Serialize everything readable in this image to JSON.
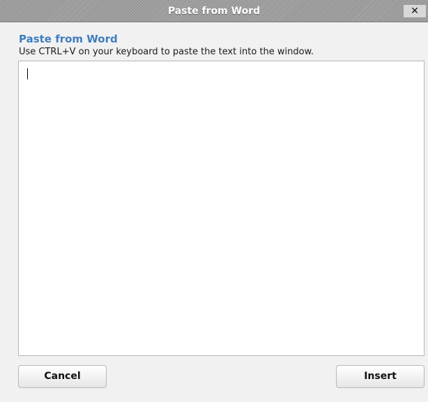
{
  "dialog": {
    "title": "Paste from Word",
    "close_label": "✕"
  },
  "content": {
    "heading": "Paste from Word",
    "instructions": "Use CTRL+V on your keyboard to paste the text into the window.",
    "paste_area_value": ""
  },
  "buttons": {
    "cancel_label": "Cancel",
    "insert_label": "Insert"
  },
  "colors": {
    "heading": "#3f7dc0",
    "titlebar": "#9a9a9a"
  }
}
